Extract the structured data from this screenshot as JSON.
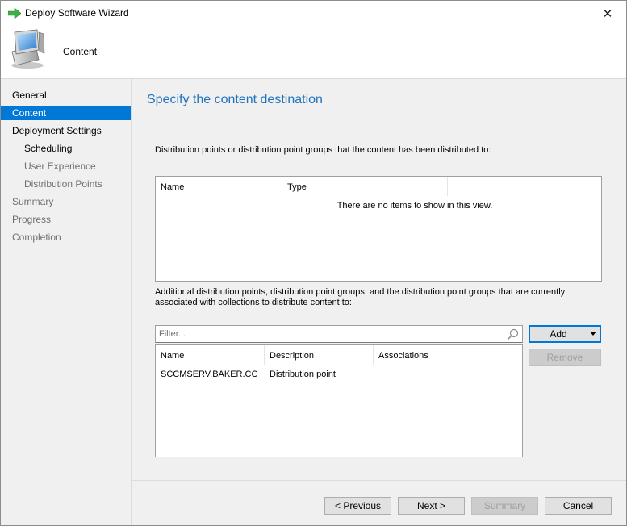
{
  "window": {
    "title": "Deploy Software Wizard",
    "close_glyph": "✕"
  },
  "header": {
    "title": "Content"
  },
  "nav": {
    "items": [
      {
        "label": "General",
        "level": 0,
        "state": "done"
      },
      {
        "label": "Content",
        "level": 0,
        "state": "active"
      },
      {
        "label": "Deployment Settings",
        "level": 0,
        "state": "done"
      },
      {
        "label": "Scheduling",
        "level": 1,
        "state": "done"
      },
      {
        "label": "User Experience",
        "level": 1,
        "state": "pending"
      },
      {
        "label": "Distribution Points",
        "level": 1,
        "state": "pending"
      },
      {
        "label": "Summary",
        "level": 0,
        "state": "pending"
      },
      {
        "label": "Progress",
        "level": 0,
        "state": "pending"
      },
      {
        "label": "Completion",
        "level": 0,
        "state": "pending"
      }
    ]
  },
  "main": {
    "heading": "Specify the content destination",
    "distributed_label": "Distribution points or distribution point groups that the content has been distributed to:",
    "distributed_list": {
      "columns": [
        "Name",
        "Type"
      ],
      "empty_text": "There are no items to show in this view."
    },
    "additional_label": "Additional distribution points, distribution point groups, and the distribution point groups that are currently associated with collections to distribute content to:",
    "filter": {
      "placeholder": "Filter..."
    },
    "add_button": {
      "label": "Add"
    },
    "remove_button": {
      "label": "Remove"
    },
    "additional_list": {
      "columns": [
        "Name",
        "Description",
        "Associations"
      ],
      "rows": [
        {
          "name": "SCCMSERV.BAKER.CC",
          "description": "Distribution point",
          "associations": ""
        }
      ]
    }
  },
  "footer": {
    "previous_label": "< Previous",
    "next_label": "Next >",
    "summary_label": "Summary",
    "cancel_label": "Cancel"
  },
  "colors": {
    "accent": "#0078d7",
    "heading": "#1e73be",
    "panel": "#f0f0f0"
  }
}
